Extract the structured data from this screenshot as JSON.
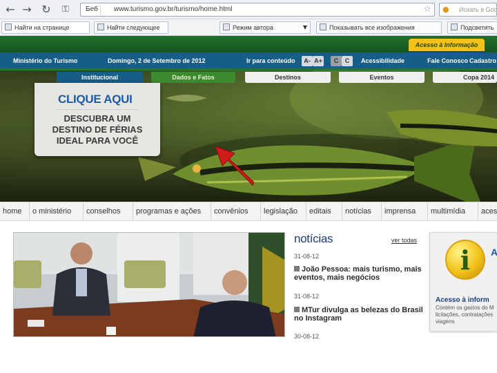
{
  "browser": {
    "site_badge": "Бeб",
    "url": "www.turismo.gov.br/turismo/home.html",
    "search_placeholder": "Искать в Google",
    "find_placeholder": "Найти на странице",
    "find_next": "Найти следующее",
    "mode_label": "Режим автора",
    "show_images": "Показывать все изображения",
    "highlight": "Подсветить"
  },
  "site": {
    "access_info": "Acesso à Informação",
    "ministry": "Ministério do Turismo",
    "date": "Domingo, 2 de Setembro de 2012",
    "skip_content": "Ir para conteúdo",
    "font_decrease": "A-",
    "font_increase": "A+",
    "contrast_1": "C",
    "contrast_2": "C",
    "accessibility": "Acessibilidade",
    "contact": "Fale Conosco",
    "register": "Cadastro"
  },
  "top_tabs": [
    "Institucional",
    "Dados e Fatos",
    "Destinos",
    "Eventos",
    "Copa 2014"
  ],
  "promo": {
    "cta": "CLIQUE AQUI",
    "lines": [
      "DESCUBRA UM",
      "DESTINO DE FÉRIAS",
      "IDEAL PARA VOCÊ"
    ]
  },
  "menu": [
    "home",
    "o ministério",
    "conselhos",
    "programas e ações",
    "convênios",
    "legislação",
    "editais",
    "notícias",
    "imprensa",
    "multimídia",
    "aces"
  ],
  "news": {
    "heading": "notícias",
    "see_all": "ver todas",
    "items": [
      {
        "date": "31-08-12",
        "title": "João Pessoa: mais turismo, mais eventos, mais negócios"
      },
      {
        "date": "31-08-12",
        "title": "MTur divulga as belezas do Brasil no Instagram"
      },
      {
        "date": "30-08-12",
        "title": ""
      }
    ]
  },
  "access_panel": {
    "icon": "info-icon",
    "title_stub": "A I",
    "link": "Acesso à inform",
    "desc": "Contém os gastos do M licitações, contratações viagens"
  },
  "colors": {
    "green": "#1f6f2c",
    "blue_bar": "#165d87",
    "yellow": "#f2c21a",
    "link_blue": "#1d5aa5"
  }
}
